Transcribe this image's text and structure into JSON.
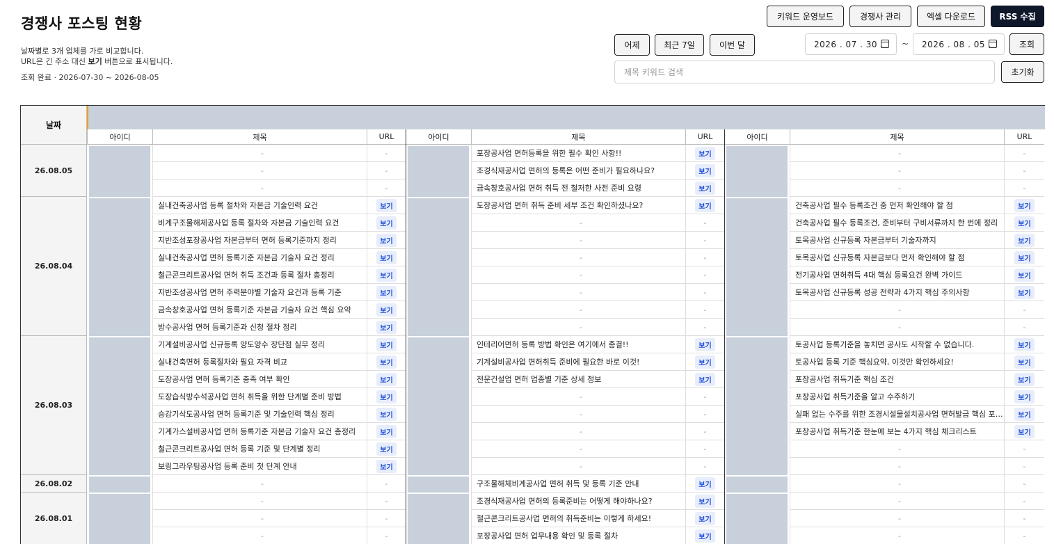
{
  "header": {
    "title": "경쟁사 포스팅 현황",
    "desc_line1": "날짜별로 3개 업체를 가로 비교합니다.",
    "desc_line2_prefix": "URL은 긴 주소 대신 ",
    "desc_line2_bold": "보기",
    "desc_line2_suffix": " 버튼으로 표시됩니다.",
    "status": "조회 완료 · 2026-07-30 ~ 2026-08-05"
  },
  "toolbar": {
    "keyword_board": "키워드 운영보드",
    "competitor_manage": "경쟁사 관리",
    "excel_download": "엑셀 다운로드",
    "rss_collect": "RSS 수집"
  },
  "filters": {
    "yesterday": "어제",
    "last7": "최근 7일",
    "this_month": "이번 달",
    "date_from": "2026 . 07 . 30 .",
    "date_to": "2026 . 08 . 05 .",
    "tilde": "~",
    "query": "조회",
    "search_placeholder": "제목 키워드 검색",
    "reset": "초기화"
  },
  "table": {
    "date_header": "날짜",
    "col_id": "아이디",
    "col_title": "제목",
    "col_url": "URL",
    "view_label": "보기",
    "dash": "-",
    "groups": [
      {
        "date": "26.08.05",
        "rows": [
          [
            "-",
            "포장공사업 면허등록을 위한 필수 확인 사항!!",
            "-"
          ],
          [
            "-",
            "조경식재공사업 면허의 등록은 어떤 준비가 필요하나요?",
            "-"
          ],
          [
            "-",
            "금속창호공사업 면허 취득 전 철저한 사전 준비 요령",
            "-"
          ]
        ]
      },
      {
        "date": "26.08.04",
        "rows": [
          [
            "실내건축공사업 등록 절차와 자본금 기술인력 요건",
            "도장공사업 면허 취득 준비 세부 조건 확인하셨나요?",
            "건축공사업 필수 등록조건 중 먼저 확인해야 할 점"
          ],
          [
            "비계구조물해체공사업 등록 절차와 자본금 기술인력 요건",
            "-",
            "건축공사업 필수 등록조건, 준비부터 구비서류까지 한 번에 정리"
          ],
          [
            "지반조성포장공사업 자본금부터 면허 등록기준까지 정리",
            "-",
            "토목공사업 신규등록 자본금부터 기술자까지"
          ],
          [
            "실내건축공사업 면허 등록기준 자본금 기술자 요건 정리",
            "-",
            "토목공사업 신규등록 자본금보다 먼저 확인해야 할 점"
          ],
          [
            "철근콘크리트공사업 면허 취득 조건과 등록 절차 총정리",
            "-",
            "전기공사업 면허취득 4대 핵심 등록요건 완벽 가이드"
          ],
          [
            "지반조성공사업 면허 주력분야별 기술자 요건과 등록 기준",
            "-",
            "토목공사업 신규등록 성공 전략과 4가지 핵심 주의사항"
          ],
          [
            "금속창호공사업 면허 등록기준 자본금 기술자 요건 핵심 요약",
            "-",
            "-"
          ],
          [
            "방수공사업 면허 등록기준과 신청 절차 정리",
            "-",
            "-"
          ]
        ]
      },
      {
        "date": "26.08.03",
        "rows": [
          [
            "기계설비공사업 신규등록 양도양수 장단점 실무 정리",
            "인테리어면허 등록 방법 확인은 여기에서 종결!!",
            "토공사업 등록기준을 놓치면 공사도 시작할 수 없습니다."
          ],
          [
            "실내건축면허 등록절차와 필요 자격 비교",
            "기계설비공사업 면허취득 준비에 필요한 바로 이것!",
            "토공사업 등록 기준 핵심요약, 이것만 확인하세요!"
          ],
          [
            "도장공사업 면허 등록기준 충족 여부 확인",
            "전문건설업 면허 업종별 기준 상세 정보",
            "포장공사업 취득기준 핵심 조건"
          ],
          [
            "도장습식방수석공사업 면허 취득을 위한 단계별 준비 방법",
            "-",
            "포장공사업 취득기준을 알고 수주하기"
          ],
          [
            "승강기삭도공사업 면허 등록기준 및 기술인력 핵심 정리",
            "-",
            "실패 없는 수주를 위한 조경시설물설치공사업 면허발급 핵심 포인트"
          ],
          [
            "기계가스설비공사업 면허 등록기준 자본금 기술자 요건 총정리",
            "-",
            "포장공사업 취득기준 한눈에 보는 4가지 핵심 체크리스트"
          ],
          [
            "철근콘크리트공사업 면허 등록 기준 및 단계별 정리",
            "-",
            "-"
          ],
          [
            "보링그라우팅공사업 등록 준비 첫 단계 안내",
            "-",
            "-"
          ]
        ]
      },
      {
        "date": "26.08.02",
        "rows": [
          [
            "-",
            "구조물해체비계공사업 면허 취득 및 등록 기준 안내",
            "-"
          ]
        ]
      },
      {
        "date": "26.08.01",
        "rows": [
          [
            "-",
            "조경식재공사업 면허의 등록준비는 어떻게 해야하나요?",
            "-"
          ],
          [
            "-",
            "철근콘크리트공사업 면허의 취득준비는 이렇게 하세요!",
            "-"
          ],
          [
            "-",
            "포장공사업 면허 업무내용 확인 및 등록 절차",
            "-"
          ]
        ]
      }
    ]
  }
}
